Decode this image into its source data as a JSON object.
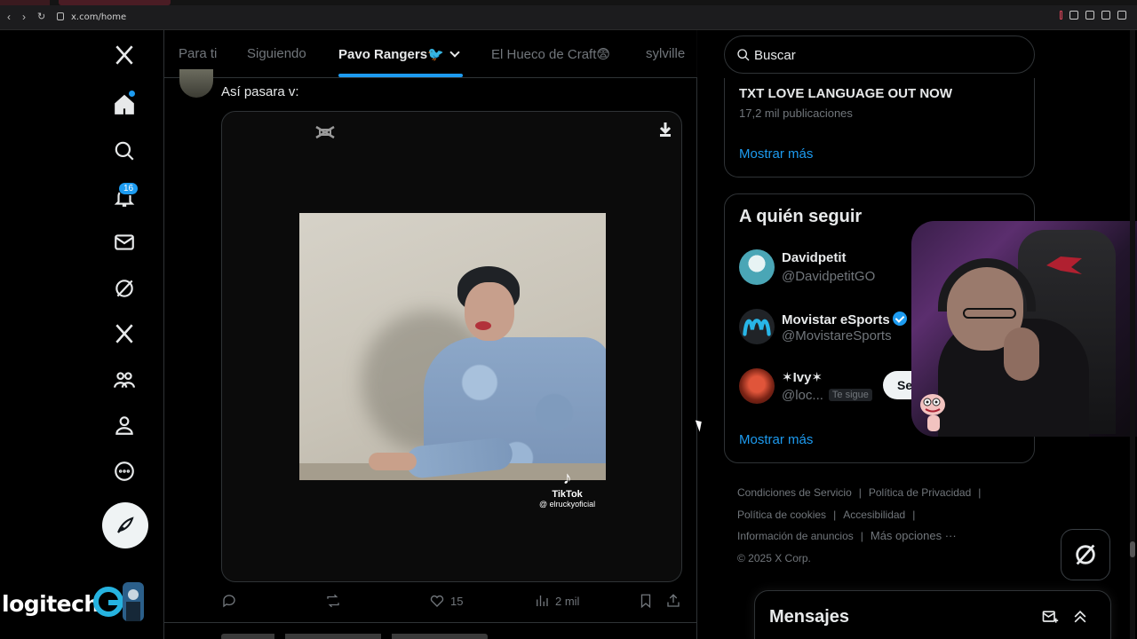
{
  "browser": {
    "url": "x.com/home",
    "back_icon": "back-arrow-icon",
    "forward_icon": "forward-arrow-icon",
    "reload_icon": "reload-icon"
  },
  "leftnav": {
    "notifications_badge": "16",
    "items": [
      "x-logo-icon",
      "home-icon",
      "explore-icon",
      "notifications-icon",
      "messages-icon",
      "grok-icon",
      "premium-icon",
      "communities-icon",
      "profile-icon",
      "more-icon"
    ],
    "post_icon": "compose-icon"
  },
  "overlay": {
    "sponsor": "logitech"
  },
  "main": {
    "tabs": [
      {
        "label": "Para ti"
      },
      {
        "label": "Siguiendo"
      },
      {
        "label": "Pavo Rangers🐦"
      },
      {
        "label": "El Hueco de Craft😨"
      },
      {
        "label": "sylville"
      }
    ],
    "active_tab": 2,
    "tweet": {
      "text": "Así pasara v:",
      "video_watermark": {
        "brand": "TikTok",
        "handle": "@ elruckyoficial"
      },
      "actions": {
        "replies": "",
        "retweets": "",
        "likes": "15",
        "views": "2 mil"
      }
    }
  },
  "right": {
    "search": {
      "placeholder": "Buscar"
    },
    "trend": {
      "title": "TXT LOVE LANGUAGE OUT NOW",
      "posts": "17,2 mil publicaciones",
      "show_more": "Mostrar más"
    },
    "who_to_follow": {
      "title": "A quién seguir",
      "users": [
        {
          "name": "Davidpetit",
          "handle": "@DavidpetitGO",
          "verified": false
        },
        {
          "name": "Movistar eSports",
          "handle": "@MovistareSports",
          "verified": true
        },
        {
          "name": "✶Ivy✶",
          "handle": "@loc...",
          "follows_you": "Te sigue"
        }
      ],
      "follow_label": "Se",
      "show_more": "Mostrar más"
    },
    "footer": {
      "terms": "Condiciones de Servicio",
      "privacy": "Política de Privacidad",
      "cookies": "Política de cookies",
      "accessibility": "Accesibilidad",
      "ads": "Información de anuncios",
      "more": "Más opciones ···",
      "copyright": "© 2025 X Corp."
    },
    "messages": {
      "title": "Mensajes"
    }
  }
}
